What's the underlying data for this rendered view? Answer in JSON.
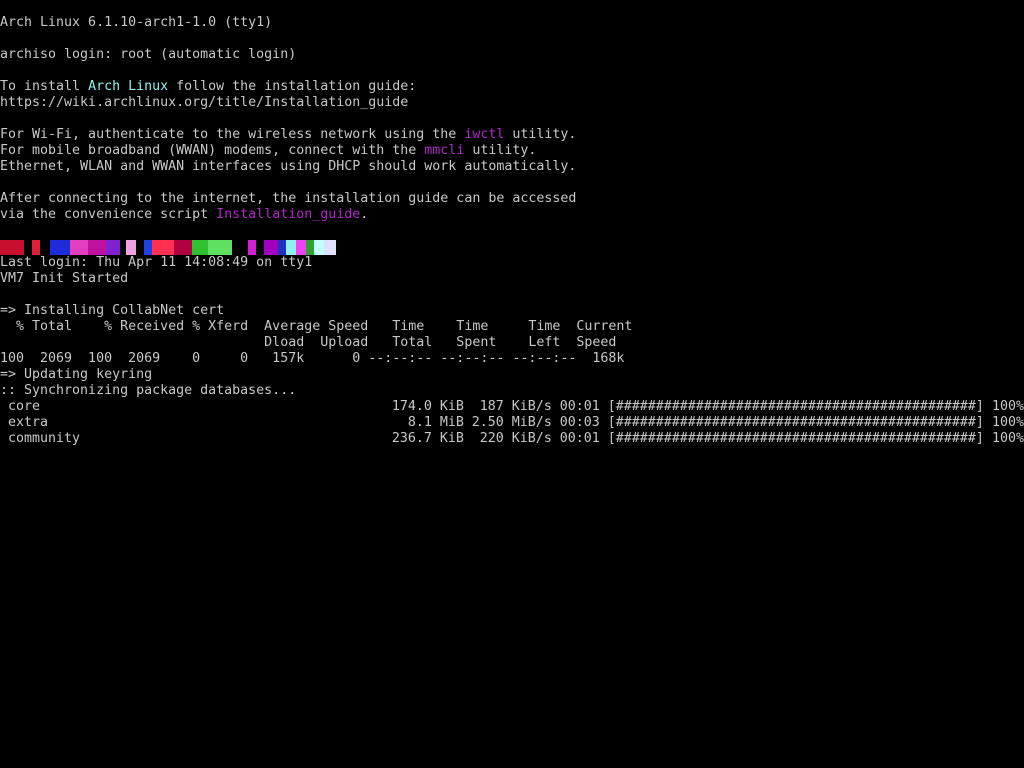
{
  "terminal": {
    "banner": "Arch Linux 6.1.10-arch1-1.0 (tty1)",
    "login_line": "archiso login: root (automatic login)",
    "install_intro": {
      "before": "To install ",
      "highlight": "Arch Linux",
      "after": " follow the installation guide:"
    },
    "guide_url": "https://wiki.archlinux.org/title/Installation_guide",
    "wifi_line": {
      "before": "For Wi-Fi, authenticate to the wireless network using the ",
      "highlight": "iwctl",
      "after": " utility."
    },
    "wwan_line": {
      "before": "For mobile broadband (WWAN) modems, connect with the ",
      "highlight": "mmcli",
      "after": " utility."
    },
    "dhcp_line": "Ethernet, WLAN and WWAN interfaces using DHCP should work automatically.",
    "after_connect_line": "After connecting to the internet, the installation guide can be accessed",
    "script_line": {
      "before": "via the convenience script ",
      "highlight": "Installation_guide",
      "after": "."
    },
    "glitch_colors": [
      "#c8102e",
      "#e0203a",
      "#1f2bd8",
      "#e040c0",
      "#c010a0",
      "#8020d0",
      "#f0a0e0",
      "#2040e0",
      "#ff3050",
      "#b00040",
      "#30c030",
      "#60e060",
      "#d020d0",
      "#a000c0",
      "#2030c0",
      "#90f0f0",
      "#f040f0",
      "#30a030",
      "#c0ffff",
      "#e0e0ff"
    ],
    "last_login": "Last login: Thu Apr 11 14:08:49 on tty1",
    "init_line": "VM7 Init Started",
    "cert_line": "=> Installing CollabNet cert",
    "curl_header_1": "  % Total    % Received % Xferd  Average Speed   Time    Time     Time  Current",
    "curl_header_2": "                                 Dload  Upload   Total   Spent    Left  Speed",
    "curl_progress": "100  2069  100  2069    0     0   157k      0 --:--:-- --:--:-- --:--:--  168k",
    "keyring_line": "=> Updating keyring",
    "sync_line": ":: Synchronizing package databases...",
    "databases": [
      {
        "name": " core",
        "size": "174.0 KiB",
        "speed": " 187 KiB/s",
        "time": "00:01",
        "bar": "[#############################################]",
        "percent": " 100%"
      },
      {
        "name": " extra",
        "size": "  8.1 MiB",
        "speed": "2.50 MiB/s",
        "time": "00:03",
        "bar": "[#############################################]",
        "percent": " 100%"
      },
      {
        "name": " community",
        "size": "236.7 KiB",
        "speed": " 220 KiB/s",
        "time": "00:01",
        "bar": "[#############################################]",
        "percent": " 100%"
      }
    ]
  },
  "colors": {
    "background": "#000000",
    "text": "#c8c8c8",
    "cyan_highlight": "#8ef2ee",
    "magenta_highlight": "#b026c8"
  }
}
